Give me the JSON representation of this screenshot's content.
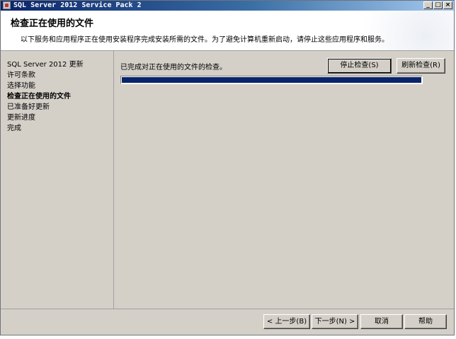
{
  "window": {
    "title": "SQL Server 2012 Service Pack 2",
    "controls": {
      "minimize": "_",
      "maximize": "□",
      "close": "×"
    }
  },
  "header": {
    "title": "检查正在使用的文件",
    "description": "以下服务和应用程序正在使用安装程序完成安装所需的文件。为了避免计算机重新启动，请停止这些应用程序和服务。"
  },
  "sidebar": {
    "items": [
      {
        "label": "SQL Server 2012 更新",
        "active": false
      },
      {
        "label": "许可条款",
        "active": false
      },
      {
        "label": "选择功能",
        "active": false
      },
      {
        "label": "检查正在使用的文件",
        "active": true
      },
      {
        "label": "已准备好更新",
        "active": false
      },
      {
        "label": "更新进度",
        "active": false
      },
      {
        "label": "完成",
        "active": false
      }
    ]
  },
  "main": {
    "status": "已完成对正在使用的文件的检查。",
    "stop_button": "停止检查(S)",
    "refresh_button": "刷新检查(R)",
    "progress": 1.0,
    "progress_color": "#0a246a"
  },
  "footer": {
    "back": "< 上一步(B)",
    "next": "下一步(N) >",
    "cancel": "取消",
    "help": "帮助"
  }
}
